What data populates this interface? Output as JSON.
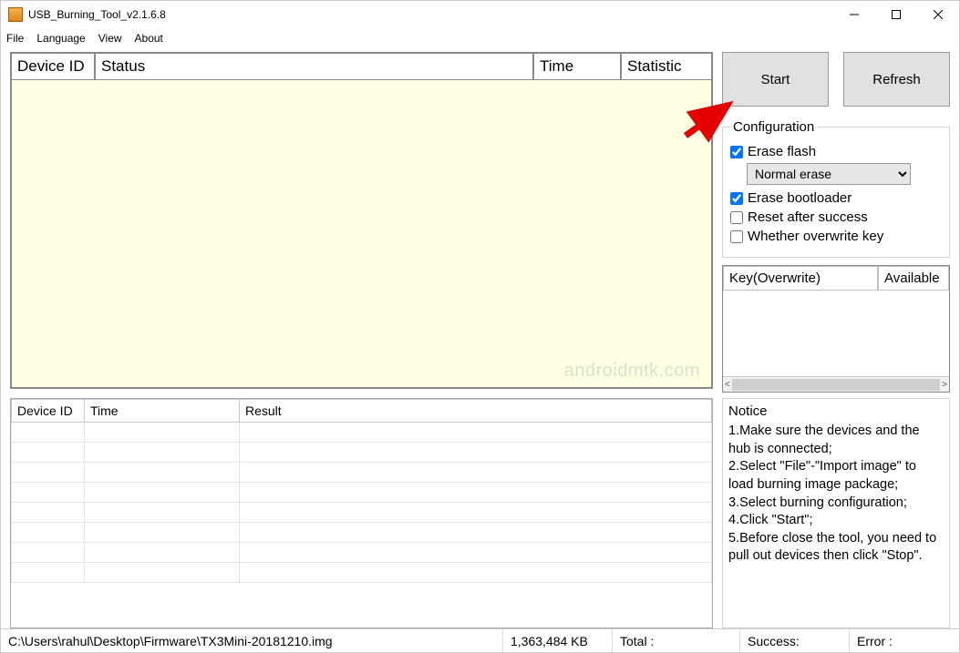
{
  "window": {
    "title": "USB_Burning_Tool_v2.1.6.8"
  },
  "menu": {
    "file": "File",
    "language": "Language",
    "view": "View",
    "about": "About"
  },
  "top_table": {
    "headers": {
      "device_id": "Device ID",
      "status": "Status",
      "time": "Time",
      "statistic": "Statistic"
    },
    "watermark": "androidmtk.com"
  },
  "bottom_table": {
    "headers": {
      "device_id": "Device ID",
      "time": "Time",
      "result": "Result"
    }
  },
  "buttons": {
    "start": "Start",
    "refresh": "Refresh"
  },
  "config": {
    "legend": "Configuration",
    "erase_flash": "Erase flash",
    "erase_mode_selected": "Normal erase",
    "erase_bootloader": "Erase bootloader",
    "reset_after_success": "Reset after success",
    "overwrite_key": "Whether overwrite key"
  },
  "key_table": {
    "col1": "Key(Overwrite)",
    "col2": "Available"
  },
  "notice": {
    "legend": "Notice",
    "l1": "1.Make sure the devices and the hub is connected;",
    "l2": "2.Select \"File\"-\"Import image\" to load burning image package;",
    "l3": "3.Select burning configuration;",
    "l4": "4.Click \"Start\";",
    "l5": "5.Before close the tool, you need to pull out devices then click \"Stop\"."
  },
  "status": {
    "path": "C:\\Users\\rahul\\Desktop\\Firmware\\TX3Mini-20181210.img",
    "size": "1,363,484 KB",
    "total_label": "Total :",
    "success_label": "Success:",
    "error_label": "Error :"
  }
}
